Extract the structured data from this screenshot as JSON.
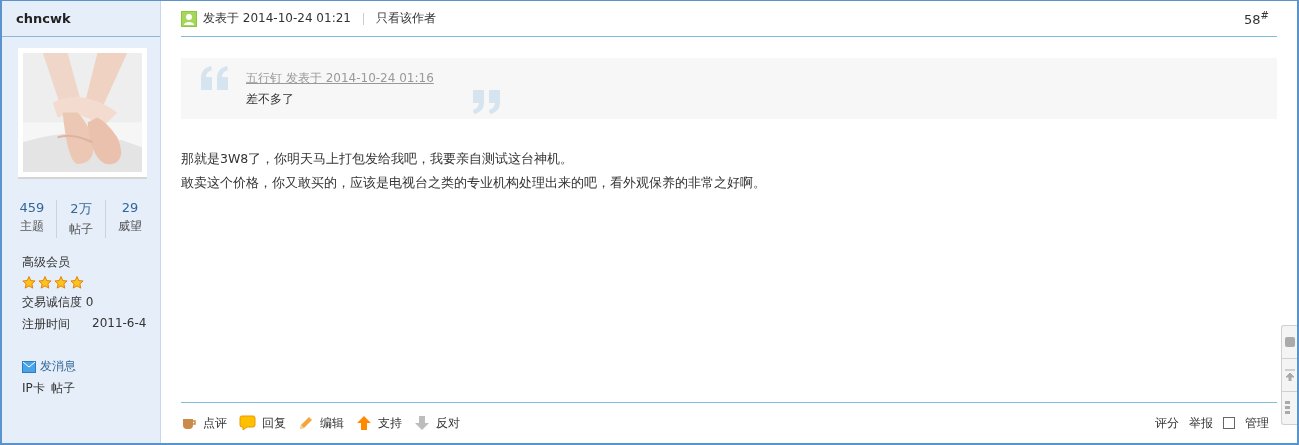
{
  "user": {
    "name": "chncwk",
    "avatar": {
      "kind": "picture"
    },
    "stats": [
      {
        "value": "459",
        "label": "主题"
      },
      {
        "value": "2万",
        "label": "帖子"
      },
      {
        "value": "29",
        "label": "威望"
      }
    ],
    "rank": "高级会员",
    "stars": 4,
    "credit": "交易诚信度 0",
    "registered_label": "注册时间",
    "registered_date": "2011-6-4",
    "message_link": "发消息",
    "magic": [
      "IP卡",
      "帖子"
    ]
  },
  "post": {
    "posted": "发表于 2014-10-24 01:21",
    "author_only": "只看该作者",
    "floor": "58$^{#}$",
    "quote": {
      "author_line": "五行钉 发表于 2014-10-24 01:16",
      "text": "差不多了"
    },
    "body": [
      "那就是3W8了，你明天马上打包发给我吧，我要亲自测试这台神机。",
      "敢卖这个价格，你又敢买的，应该是电视台之类的专业机构处理出来的吧，看外观保养的非常之好啊。"
    ],
    "actions": [
      {
        "kind": "comment",
        "label": "点评"
      },
      {
        "kind": "reply",
        "label": "回复"
      },
      {
        "kind": "edit",
        "label": "编辑"
      },
      {
        "kind": "support",
        "label": "支持"
      },
      {
        "kind": "oppose",
        "label": "反对"
      }
    ],
    "right_actions": [
      "评分",
      "举报"
    ],
    "manage": {
      "label": "管理",
      "checked": false
    }
  }
}
